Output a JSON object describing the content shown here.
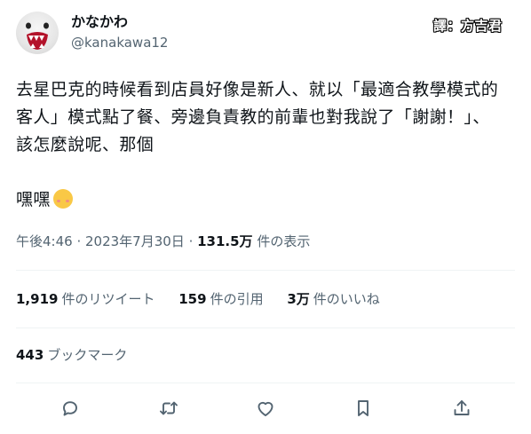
{
  "author": {
    "display_name": "かなかわ",
    "handle": "@kanakawa12",
    "avatar_icon": "fanged-mascot-avatar"
  },
  "translator_credit": "譯：方吉君",
  "tweet": {
    "paragraphs": [
      "去星巴克的時候看到店員好像是新人、就以「最適合教學模式的",
      "客人」模式點了餐、旁邊負責教的前輩也對我說了「謝謝！」、",
      "該怎麼說呢、那個",
      "嘿嘿"
    ],
    "emoji": "smiling-blushing-face"
  },
  "meta": {
    "timestamp": "午後4:46 · 2023年7月30日",
    "separator": " · ",
    "views_count": "131.5万",
    "views_label": " 件の表示"
  },
  "stats": {
    "retweets_count": "1,919",
    "retweets_label": "件のリツイート",
    "quotes_count": "159",
    "quotes_label": "件の引用",
    "likes_count": "3万",
    "likes_label": "件のいいね"
  },
  "bookmarks": {
    "count": "443",
    "label": "ブックマーク"
  },
  "actions": [
    {
      "name": "reply-icon"
    },
    {
      "name": "retweet-icon"
    },
    {
      "name": "like-icon"
    },
    {
      "name": "bookmark-icon"
    },
    {
      "name": "share-icon"
    }
  ],
  "colors": {
    "text": "#0f1419",
    "secondary": "#536471",
    "divider": "#eff3f4"
  }
}
